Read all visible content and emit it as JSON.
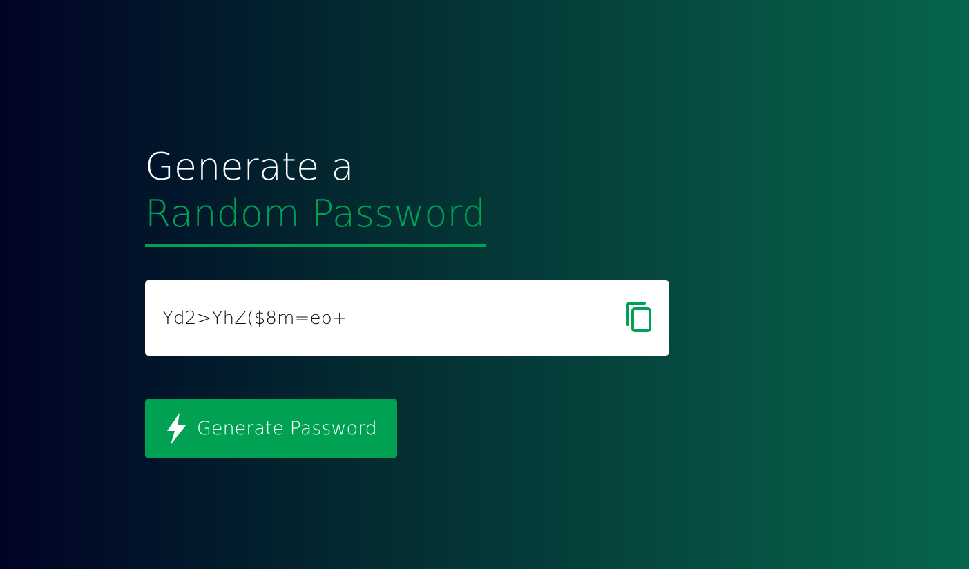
{
  "heading": {
    "line1": "Generate a",
    "line2": "Random Password"
  },
  "password_display": {
    "value": "Yd2>YhZ($8m=eo+",
    "copy_icon": "copy-icon"
  },
  "generate_button": {
    "label": "Generate Password",
    "icon": "lightning-bolt-icon"
  },
  "colors": {
    "accent": "#00a152",
    "background_start": "#010326",
    "background_end": "#06654c",
    "display_bg": "#ffffff"
  }
}
